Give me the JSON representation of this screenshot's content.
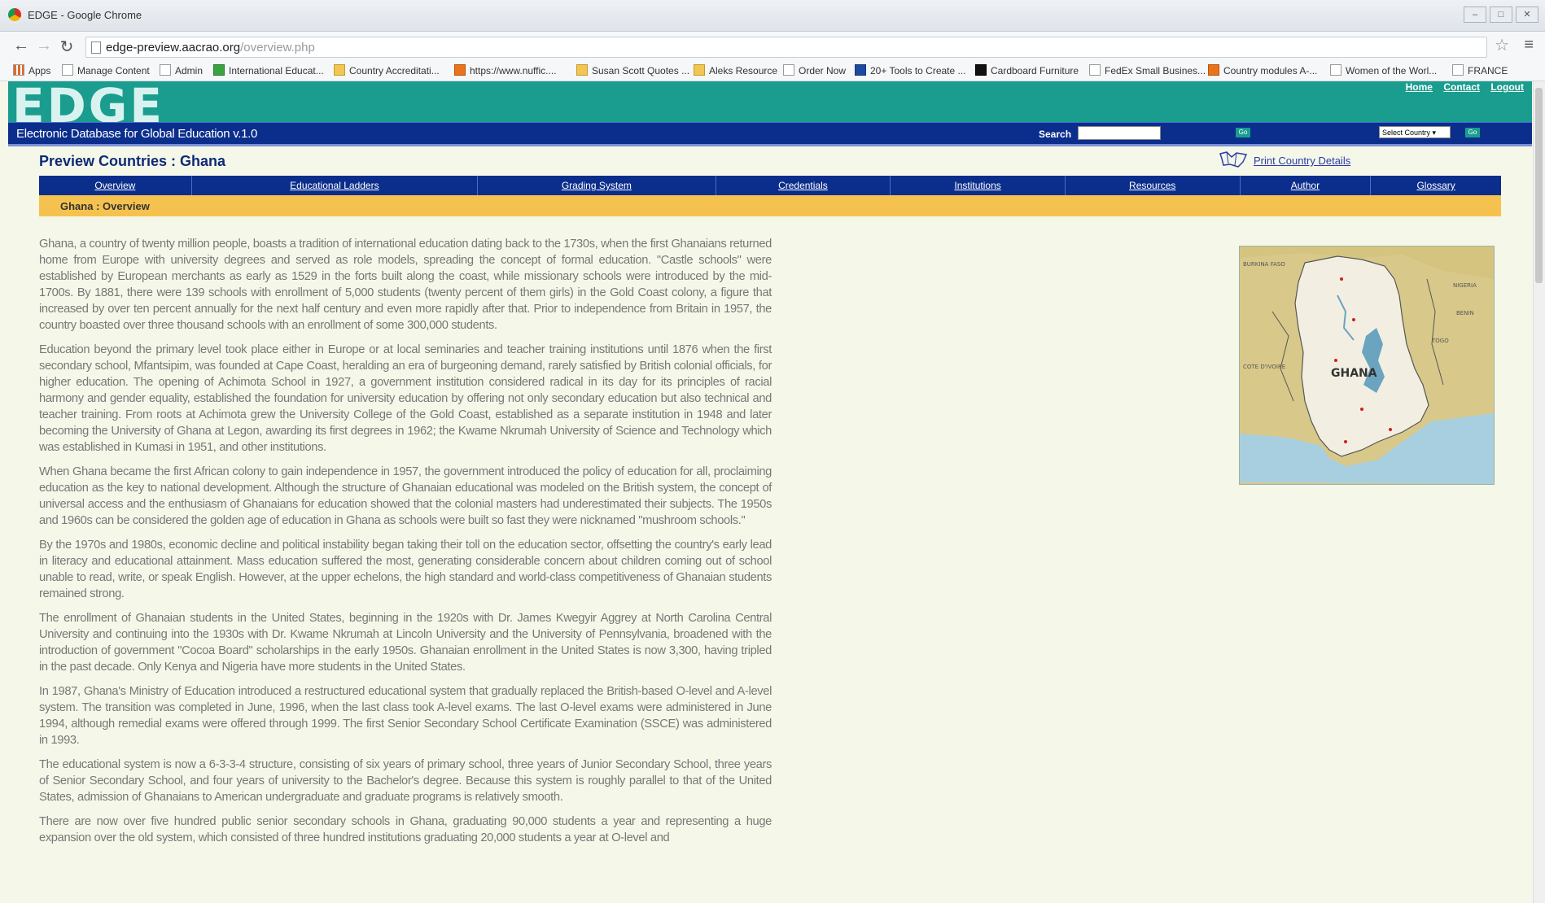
{
  "window": {
    "title": "EDGE - Google Chrome"
  },
  "browser": {
    "url_host": "edge-preview.aacrao.org",
    "url_path": "/overview.php",
    "bookmarks": [
      {
        "label": "Apps",
        "icon": "apps-icon"
      },
      {
        "label": "Manage Content",
        "icon": "page-icon"
      },
      {
        "label": "Admin",
        "icon": "page-icon"
      },
      {
        "label": "International Educat...",
        "icon": "site-icon"
      },
      {
        "label": "Country Accreditati...",
        "icon": "folder-icon"
      },
      {
        "label": "https://www.nuffic....",
        "icon": "site-icon"
      },
      {
        "label": "Susan Scott Quotes ...",
        "icon": "bulb-icon"
      },
      {
        "label": "Aleks Resource",
        "icon": "folder-icon"
      },
      {
        "label": "Order Now",
        "icon": "page-icon"
      },
      {
        "label": "20+ Tools to Create ...",
        "icon": "site-icon"
      },
      {
        "label": "Cardboard Furniture",
        "icon": "site-icon"
      },
      {
        "label": "FedEx Small Busines...",
        "icon": "page-icon"
      },
      {
        "label": "Country modules A-...",
        "icon": "site-icon"
      },
      {
        "label": "Women of the Worl...",
        "icon": "page-icon"
      },
      {
        "label": "FRANCE",
        "icon": "page-icon"
      }
    ]
  },
  "site": {
    "logo": "EDGE",
    "subtitle": "Electronic Database for Global Education v.1.0",
    "top_links": [
      "Home",
      "Contact",
      "Logout"
    ],
    "search_label": "Search",
    "go_label": "Go",
    "country_select": "Select Country"
  },
  "page": {
    "heading": "Preview Countries : Ghana",
    "print_link": "Print Country Details",
    "tabs": [
      "Overview",
      "Educational Ladders",
      "Grading System",
      "Credentials",
      "Institutions",
      "Resources",
      "Author",
      "Glossary"
    ],
    "breadcrumb": "Ghana : Overview",
    "paragraphs": [
      "Ghana, a country of twenty million people, boasts a tradition of international education dating back to the 1730s, when the first Ghanaians returned home from Europe with university degrees and served as role models, spreading the concept of formal education. \"Castle schools\" were established by European merchants as early as 1529 in the forts built along the coast, while missionary schools were introduced by the mid-1700s. By 1881, there were 139 schools with enrollment of 5,000 students (twenty percent of them girls) in the Gold Coast colony, a figure that increased by over ten percent annually for the next half century and even more rapidly after that. Prior to independence from Britain in 1957, the country boasted over three thousand schools with an enrollment of some 300,000 students.",
      "Education beyond the primary level took place either in Europe or at local seminaries and teacher training institutions until 1876 when the first secondary school, Mfantsipim, was founded at Cape Coast, heralding an era of burgeoning demand, rarely satisfied by British colonial officials, for higher education. The opening of Achimota School in 1927, a government institution considered radical in its day for its principles of racial harmony and gender equality, established the foundation for university education by offering not only secondary education but also technical and teacher training. From roots at Achimota grew the University College of the Gold Coast, established as a separate institution in 1948 and later becoming the University of Ghana at Legon, awarding its first degrees in 1962; the Kwame Nkrumah University of Science and Technology which was established in Kumasi in 1951, and other institutions.",
      "When Ghana became the first African colony to gain independence in 1957, the government introduced the policy of education for all, proclaiming education as the key to national development. Although the structure of Ghanaian educational was modeled on the British system, the concept of universal access and the enthusiasm of Ghanaians for education showed that the colonial masters had underestimated their subjects. The 1950s and 1960s can be considered the golden age of education in Ghana as schools were built so fast they were nicknamed \"mushroom schools.\"",
      "By the 1970s and 1980s, economic decline and political instability began taking their toll on the education sector, offsetting the country's early lead in literacy and educational attainment. Mass education suffered the most, generating considerable concern about children coming out of school unable to read, write, or speak English. However, at the upper echelons, the high standard and world-class competitiveness of Ghanaian students remained strong.",
      "The enrollment of Ghanaian students in the United States, beginning in the 1920s with Dr. James Kwegyir Aggrey at North Carolina Central University and continuing into the 1930s with Dr. Kwame Nkrumah at Lincoln University and the University of Pennsylvania, broadened with the introduction of government \"Cocoa Board\" scholarships in the early 1950s. Ghanaian enrollment in the United States is now 3,300, having tripled in the past decade. Only Kenya and Nigeria have more students in the United States.",
      "In 1987, Ghana's Ministry of Education introduced a restructured educational system that gradually replaced the British-based O-level and A-level system. The transition was completed in June, 1996, when the last class took A-level exams. The last O-level exams were administered in June 1994, although remedial exams were offered through 1999. The first Senior Secondary School Certificate Examination (SSCE) was administered in 1993.",
      "The educational system is now a 6-3-3-4 structure, consisting of six years of primary school, three years of Junior Secondary School, three years of Senior Secondary School, and four years of university to the Bachelor's degree. Because this system is roughly parallel to that of the United States, admission of Ghanaians to American undergraduate and graduate programs is relatively smooth.",
      "There are now over five hundred public senior secondary schools in Ghana, graduating 90,000 students a year and representing a huge expansion over the old system, which consisted of three hundred institutions graduating 20,000 students a year at O-level and"
    ],
    "map_labels": {
      "country": "GHANA",
      "neighbors": [
        "BURKINA FASO",
        "NIGERIA",
        "BENIN",
        "TOGO",
        "COTE D'IVOIRE"
      ]
    }
  },
  "colors": {
    "teal_banner": "#1a9d8f",
    "navy_bar": "#0b2e8c",
    "breadcrumb_gold": "#f6c24f",
    "page_bg": "#f5f8e8"
  }
}
